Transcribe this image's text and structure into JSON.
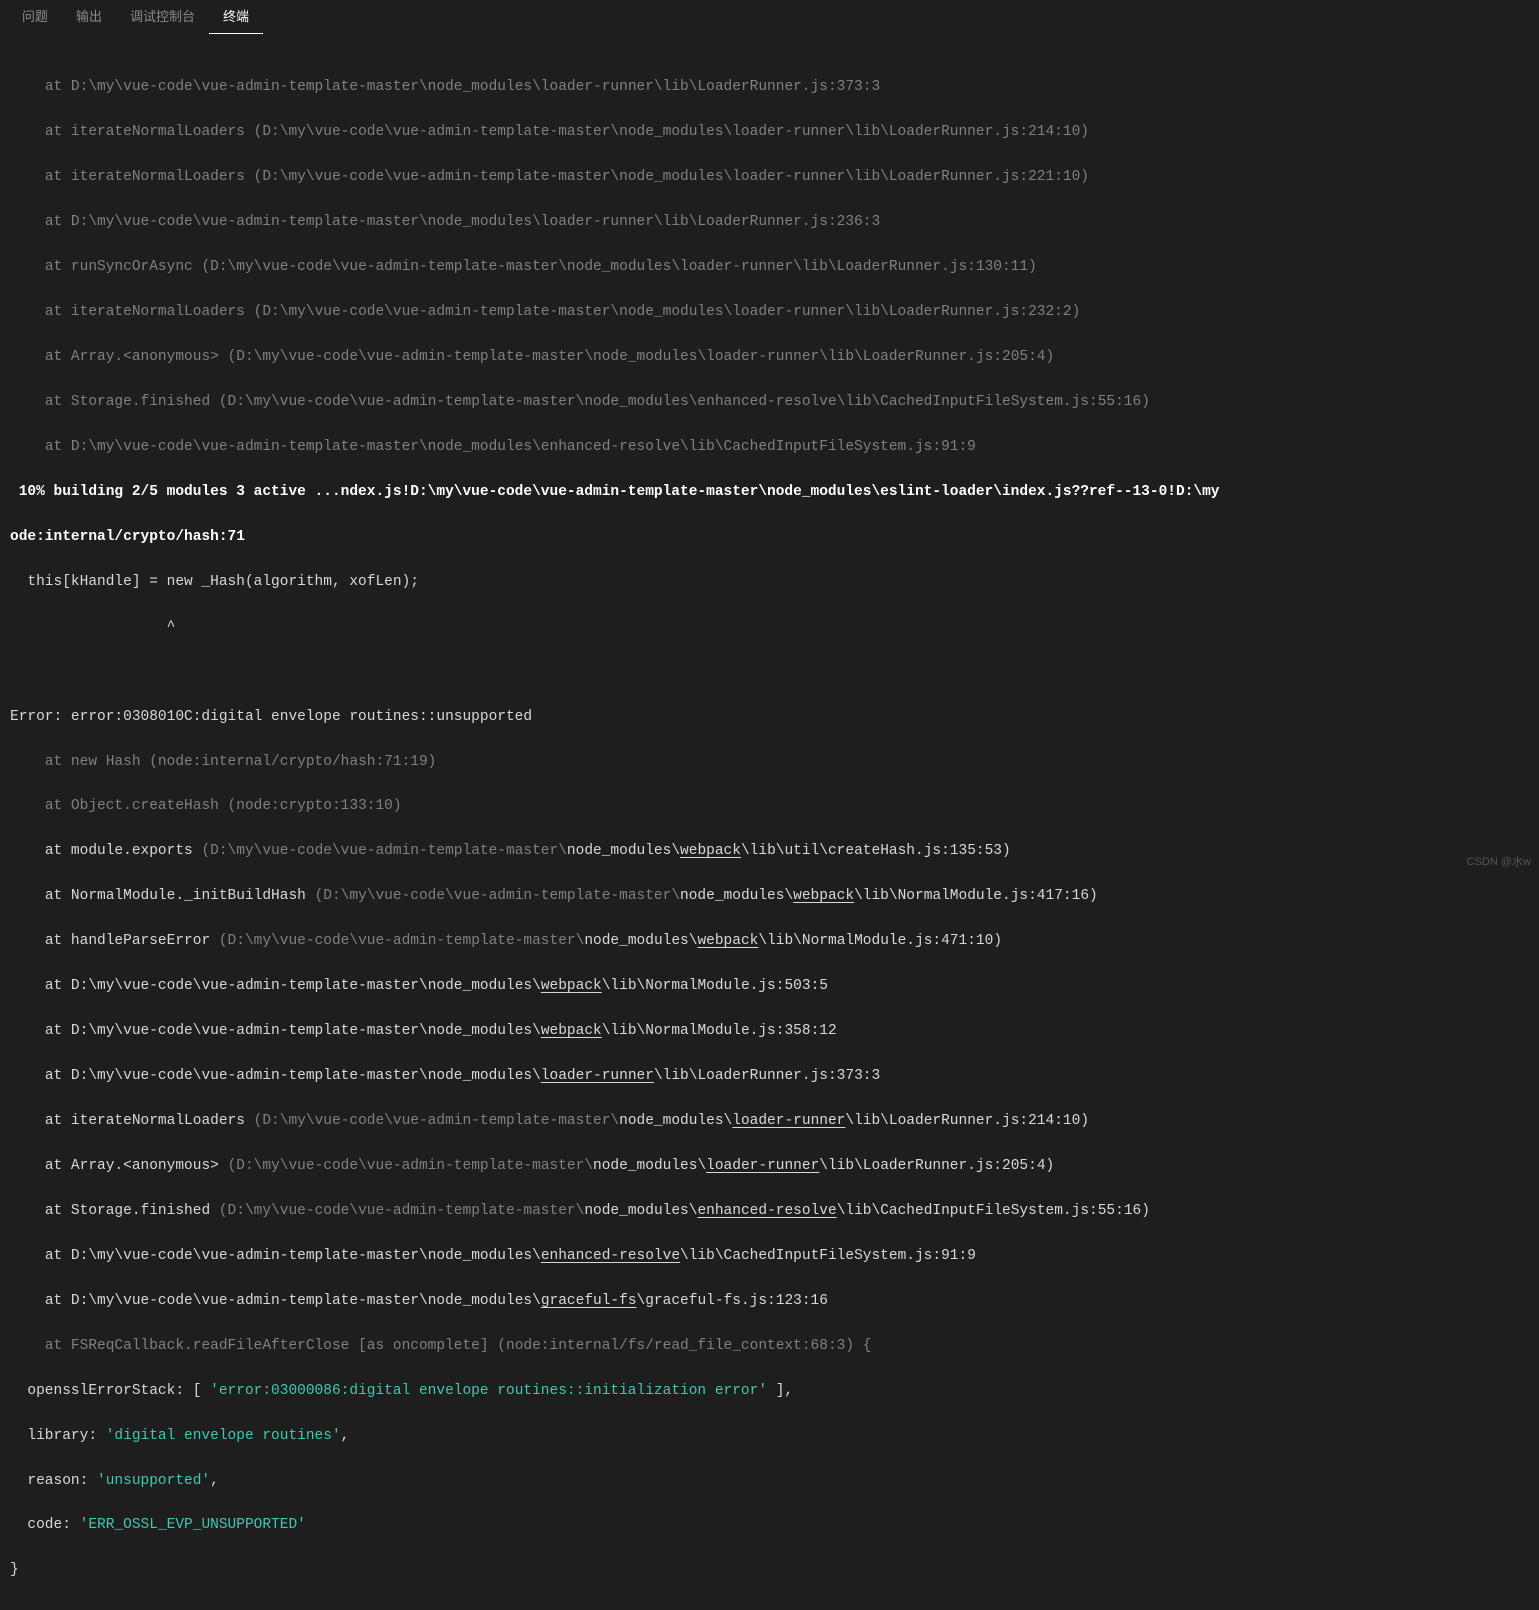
{
  "tabs": {
    "problems": "问题",
    "output": "输出",
    "debug": "调试控制台",
    "terminal": "终端"
  },
  "watermark": "CSDN @水w",
  "term": {
    "ind1": "    ",
    "ind2": "  ",
    "at": "at ",
    "l01": "D:\\my\\vue-code\\vue-admin-template-master\\node_modules\\loader-runner\\lib\\LoaderRunner.js:373:3",
    "l02a": "iterateNormalLoaders ",
    "l02b": "(D:\\my\\vue-code\\vue-admin-template-master\\node_modules\\loader-runner\\lib\\LoaderRunner.js:214:10)",
    "l03b": "(D:\\my\\vue-code\\vue-admin-template-master\\node_modules\\loader-runner\\lib\\LoaderRunner.js:221:10)",
    "l04": "D:\\my\\vue-code\\vue-admin-template-master\\node_modules\\loader-runner\\lib\\LoaderRunner.js:236:3",
    "l05a": "runSyncOrAsync ",
    "l05b": "(D:\\my\\vue-code\\vue-admin-template-master\\node_modules\\loader-runner\\lib\\LoaderRunner.js:130:11)",
    "l06b": "(D:\\my\\vue-code\\vue-admin-template-master\\node_modules\\loader-runner\\lib\\LoaderRunner.js:232:2)",
    "l07a": "Array.<anonymous> ",
    "l07b": "(D:\\my\\vue-code\\vue-admin-template-master\\node_modules\\loader-runner\\lib\\LoaderRunner.js:205:4)",
    "l08a": "Storage.finished ",
    "l08b": "(D:\\my\\vue-code\\vue-admin-template-master\\node_modules\\enhanced-resolve\\lib\\CachedInputFileSystem.js:55:16)",
    "l09": "D:\\my\\vue-code\\vue-admin-template-master\\node_modules\\enhanced-resolve\\lib\\CachedInputFileSystem.js:91:9",
    "build1": " 10% building 2/5 modules 3 active ...ndex.js!D:\\my\\vue-code\\vue-admin-template-master\\node_modules\\eslint-loader\\index.js??ref--13-0!D:\\my",
    "build2": "ode:internal/crypto/hash:71",
    "hashLine": "  this[kHandle] = new _Hash(algorithm, xofLen);",
    "caret": "                  ^",
    "errHead": "Error: error:0308010C:digital envelope routines::unsupported",
    "e01": "at new Hash (node:internal/crypto/hash:71:19)",
    "e02": "at Object.createHash (node:crypto:133:10)",
    "e03a": "module.exports ",
    "e03b": "(D:\\my\\vue-code\\vue-admin-template-master\\",
    "e03c": "node_modules\\",
    "e03d": "webpack",
    "e03e": "\\lib\\util\\createHash.js:135:53)",
    "e04a": "NormalModule._initBuildHash ",
    "e04b": "(D:\\my\\vue-code\\vue-admin-template-master\\",
    "e04e": "\\lib\\NormalModule.js:417:16)",
    "e05a": "handleParseError ",
    "e05e": "\\lib\\NormalModule.js:471:10)",
    "e06a": "D:\\my\\vue-code\\vue-admin-template-master\\",
    "e06e": "\\lib\\NormalModule.js:503:5",
    "e07e": "\\lib\\NormalModule.js:358:12",
    "lrun": "loader-runner",
    "e08e": "\\lib\\LoaderRunner.js:373:3",
    "e09b": "(D:\\my\\vue-code\\vue-admin-template-master\\",
    "e09e": "\\lib\\LoaderRunner.js:214:10)",
    "e10e": "\\lib\\LoaderRunner.js:205:4)",
    "eres": "enhanced-resolve",
    "e11e": "\\lib\\CachedInputFileSystem.js:55:16)",
    "e12e": "\\lib\\CachedInputFileSystem.js:91:9",
    "gfs": "graceful-fs",
    "e13e": "\\graceful-fs.js:123:16",
    "e14": "at FSReqCallback.readFileAfterClose [as oncomplete] (node:internal/fs/read_file_context:68:3) {",
    "oss1a": "  opensslErrorStack: [ ",
    "oss1b": "'error:03000086:digital envelope routines::initialization error'",
    "oss1c": " ],",
    "oss2a": "  library: ",
    "oss2b": "'digital envelope routines'",
    "comma": ",",
    "oss3a": "  reason: ",
    "oss3b": "'unsupported'",
    "oss4a": "  code: ",
    "oss4b": "'ERR_OSSL_EVP_UNSUPPORTED'",
    "close": "}"
  }
}
